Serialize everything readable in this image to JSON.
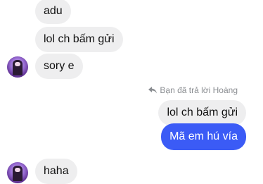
{
  "messages": {
    "incoming_1": "adu",
    "incoming_2": "lol ch bấm gửi",
    "incoming_3": "sory e",
    "reply_note": "Bạn đã trả lời Hoàng",
    "quoted": "lol ch bấm gửi",
    "outgoing": "Mã em hú vía",
    "incoming_4": "haha"
  },
  "colors": {
    "outgoing_bubble": "#3b5bf6",
    "incoming_bubble": "#eeeeef"
  }
}
